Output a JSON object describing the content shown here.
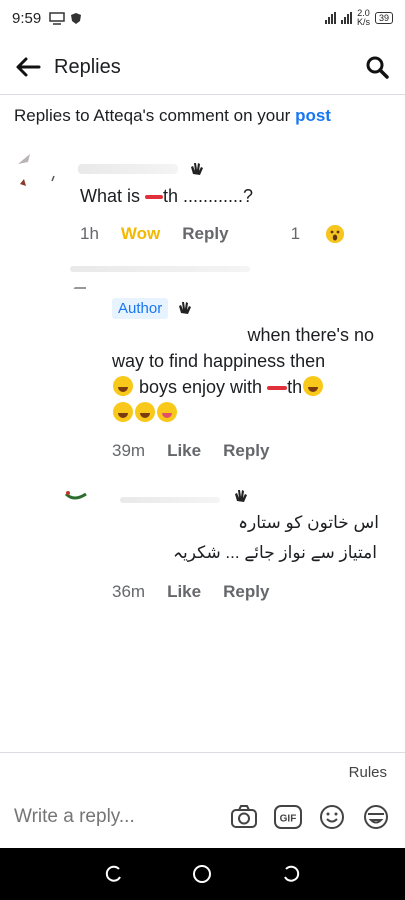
{
  "status_bar": {
    "time": "9:59",
    "net_speed_value": "2.0",
    "net_speed_unit": "K/s",
    "battery": "39"
  },
  "header": {
    "title": "Replies",
    "back_icon": "arrow-left-icon",
    "search_icon": "search-icon"
  },
  "context": {
    "prefix": "Replies to Atteqa's comment on your ",
    "link": "post"
  },
  "comment_1": {
    "text_before": "What is ",
    "text_after": "th ............?",
    "time": "1h",
    "reaction_label": "Wow",
    "reply_label": "Reply",
    "reaction_count": "1"
  },
  "comment_2": {
    "badge": "Author",
    "line1": "when there's no",
    "line2": "way to find happiness  then",
    "line3_a": " boys enjoy with ",
    "line3_b": "th",
    "time": "39m",
    "like_label": "Like",
    "reply_label": "Reply"
  },
  "comment_3": {
    "line1": "اس خاتون کو ستارہ",
    "line2": "امتیاز سے نواز جائے ... شکریہ",
    "time": "36m",
    "like_label": "Like",
    "reply_label": "Reply"
  },
  "footer": {
    "rules_label": "Rules",
    "reply_placeholder": "Write a reply...",
    "gif_label": "GIF"
  }
}
